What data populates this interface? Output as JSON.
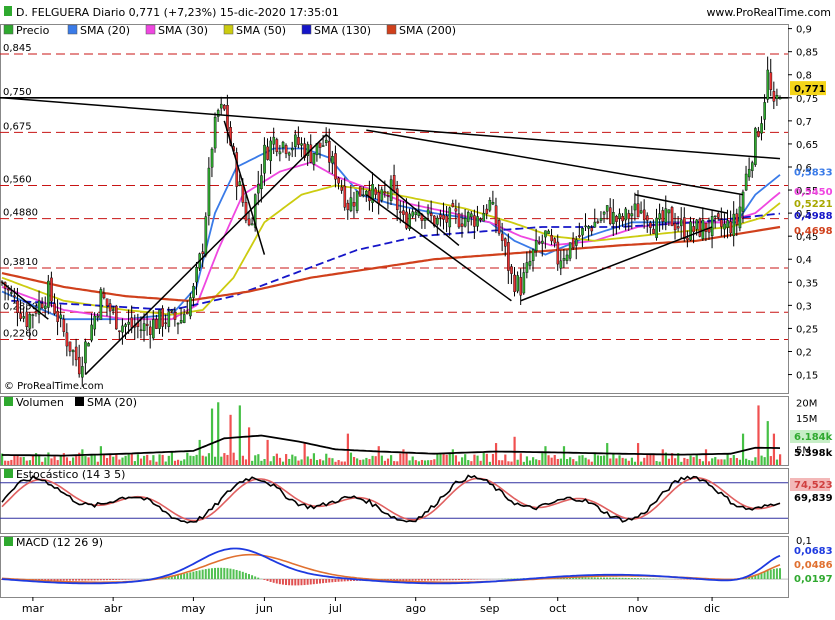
{
  "header": {
    "title": "D. FELGUERA Diario 0,771 (+7,23%) 15-dic-2020 17:35:01",
    "site": "www.ProRealTime.com",
    "copyright": "© ProRealTime.com"
  },
  "colors": {
    "price_up": "#2fa92f",
    "price_down": "#e63030",
    "sma20": "#3a7be8",
    "sma30": "#ef47e0",
    "sma50": "#cccc10",
    "sma130": "#1515c8",
    "sma200": "#d0401c",
    "resistance": "#c81414",
    "trendline": "#000000",
    "volume_up": "#45c045",
    "volume_down": "#f05050",
    "stoch_k": "#000000",
    "stoch_d": "#e06060",
    "stoch_fill": "#c8c8c8",
    "macd_line": "#1e3ae0",
    "macd_signal": "#e07030",
    "hist_pos": "#52c052",
    "hist_neg": "#e05050",
    "axis_highlight_last": "#f5d51a"
  },
  "chart_data": [
    {
      "panel": "price",
      "type": "candlestick",
      "legend": [
        {
          "name": "Precio",
          "color": "#2fa92f"
        },
        {
          "name": "SMA (20)",
          "color": "#3a7be8"
        },
        {
          "name": "SMA (30)",
          "color": "#ef47e0"
        },
        {
          "name": "SMA (50)",
          "color": "#cccc10"
        },
        {
          "name": "SMA (130)",
          "color": "#1515c8"
        },
        {
          "name": "SMA (200)",
          "color": "#d0401c"
        }
      ],
      "x_months": [
        "mar",
        "abr",
        "may",
        "jun",
        "jul",
        "ago",
        "sep",
        "oct",
        "nov",
        "dic"
      ],
      "ylim": [
        0.11,
        0.91
      ],
      "y_ticks": [
        "0,9",
        "0,85",
        "0,8",
        "0,75",
        "0,7",
        "0,65",
        "0,6",
        "0,55",
        "0,5",
        "0,45",
        "0,4",
        "0,35",
        "0,3",
        "0,25",
        "0,2",
        "0,15"
      ],
      "resistance_levels": [
        {
          "value": 0.845,
          "label": "0,845"
        },
        {
          "value": 0.75,
          "label": "0,750"
        },
        {
          "value": 0.675,
          "label": "0,675"
        },
        {
          "value": 0.56,
          "label": "0,560"
        },
        {
          "value": 0.488,
          "label": "0,4880"
        },
        {
          "value": 0.381,
          "label": "0,3810"
        },
        {
          "value": 0.285,
          "label": "0,2850"
        },
        {
          "value": 0.226,
          "label": "0,2260"
        }
      ],
      "last_values": [
        {
          "label": "0,771",
          "value": 0.771,
          "color": "#000000",
          "bg": "#f5d51a"
        },
        {
          "label": "0,5833",
          "value": 0.5833,
          "color": "#3a7be8"
        },
        {
          "label": "0,5450",
          "value": 0.545,
          "color": "#ef47e0"
        },
        {
          "label": "0,5221",
          "value": 0.5221,
          "color": "#a8a800"
        },
        {
          "label": "0,4988",
          "value": 0.4988,
          "color": "#1515c8"
        },
        {
          "label": "0,4698",
          "value": 0.4698,
          "color": "#d0401c"
        }
      ],
      "anchors": [
        [
          0,
          0.35
        ],
        [
          8,
          0.27
        ],
        [
          15,
          0.33
        ],
        [
          20,
          0.24
        ],
        [
          25,
          0.17
        ],
        [
          32,
          0.32
        ],
        [
          38,
          0.26
        ],
        [
          45,
          0.25
        ],
        [
          52,
          0.27
        ],
        [
          58,
          0.27
        ],
        [
          62,
          0.33
        ],
        [
          65,
          0.43
        ],
        [
          68,
          0.65
        ],
        [
          70,
          0.72
        ],
        [
          72,
          0.72
        ],
        [
          76,
          0.58
        ],
        [
          80,
          0.47
        ],
        [
          85,
          0.63
        ],
        [
          88,
          0.66
        ],
        [
          92,
          0.65
        ],
        [
          96,
          0.65
        ],
        [
          100,
          0.63
        ],
        [
          104,
          0.65
        ],
        [
          108,
          0.59
        ],
        [
          112,
          0.52
        ],
        [
          118,
          0.56
        ],
        [
          122,
          0.52
        ],
        [
          126,
          0.55
        ],
        [
          130,
          0.48
        ],
        [
          134,
          0.52
        ],
        [
          138,
          0.49
        ],
        [
          142,
          0.48
        ],
        [
          146,
          0.49
        ],
        [
          150,
          0.49
        ],
        [
          154,
          0.49
        ],
        [
          158,
          0.52
        ],
        [
          162,
          0.44
        ],
        [
          165,
          0.36
        ],
        [
          168,
          0.34
        ],
        [
          172,
          0.41
        ],
        [
          176,
          0.45
        ],
        [
          180,
          0.4
        ],
        [
          184,
          0.43
        ],
        [
          190,
          0.47
        ],
        [
          196,
          0.5
        ],
        [
          200,
          0.48
        ],
        [
          204,
          0.5
        ],
        [
          208,
          0.51
        ],
        [
          212,
          0.47
        ],
        [
          216,
          0.49
        ],
        [
          222,
          0.46
        ],
        [
          228,
          0.47
        ],
        [
          234,
          0.47
        ],
        [
          238,
          0.48
        ],
        [
          241,
          0.58
        ],
        [
          244,
          0.66
        ],
        [
          246,
          0.71
        ],
        [
          248,
          0.8
        ],
        [
          250,
          0.72
        ],
        [
          252,
          0.771
        ]
      ],
      "sma_anchors": {
        "sma20": [
          [
            0,
            0.33
          ],
          [
            20,
            0.27
          ],
          [
            40,
            0.27
          ],
          [
            55,
            0.28
          ],
          [
            63,
            0.34
          ],
          [
            69,
            0.5
          ],
          [
            76,
            0.6
          ],
          [
            88,
            0.64
          ],
          [
            98,
            0.64
          ],
          [
            106,
            0.62
          ],
          [
            116,
            0.54
          ],
          [
            126,
            0.52
          ],
          [
            140,
            0.5
          ],
          [
            150,
            0.49
          ],
          [
            158,
            0.48
          ],
          [
            166,
            0.44
          ],
          [
            176,
            0.41
          ],
          [
            190,
            0.45
          ],
          [
            204,
            0.48
          ],
          [
            216,
            0.48
          ],
          [
            228,
            0.48
          ],
          [
            238,
            0.48
          ],
          [
            244,
            0.54
          ],
          [
            252,
            0.583
          ]
        ],
        "sma30": [
          [
            0,
            0.34
          ],
          [
            20,
            0.29
          ],
          [
            40,
            0.27
          ],
          [
            55,
            0.27
          ],
          [
            63,
            0.3
          ],
          [
            70,
            0.42
          ],
          [
            78,
            0.54
          ],
          [
            90,
            0.59
          ],
          [
            100,
            0.61
          ],
          [
            108,
            0.58
          ],
          [
            120,
            0.55
          ],
          [
            132,
            0.52
          ],
          [
            146,
            0.5
          ],
          [
            158,
            0.48
          ],
          [
            168,
            0.45
          ],
          [
            178,
            0.43
          ],
          [
            192,
            0.44
          ],
          [
            206,
            0.47
          ],
          [
            220,
            0.48
          ],
          [
            234,
            0.48
          ],
          [
            244,
            0.5
          ],
          [
            252,
            0.545
          ]
        ],
        "sma50": [
          [
            0,
            0.36
          ],
          [
            20,
            0.31
          ],
          [
            40,
            0.29
          ],
          [
            55,
            0.28
          ],
          [
            65,
            0.29
          ],
          [
            75,
            0.36
          ],
          [
            85,
            0.48
          ],
          [
            97,
            0.54
          ],
          [
            108,
            0.56
          ],
          [
            120,
            0.55
          ],
          [
            135,
            0.53
          ],
          [
            150,
            0.51
          ],
          [
            165,
            0.48
          ],
          [
            178,
            0.45
          ],
          [
            192,
            0.44
          ],
          [
            206,
            0.45
          ],
          [
            220,
            0.46
          ],
          [
            236,
            0.47
          ],
          [
            246,
            0.49
          ],
          [
            252,
            0.522
          ]
        ],
        "sma130": [
          [
            3,
            0.31
          ],
          [
            30,
            0.3
          ],
          [
            55,
            0.29
          ],
          [
            75,
            0.32
          ],
          [
            95,
            0.37
          ],
          [
            115,
            0.42
          ],
          [
            135,
            0.45
          ],
          [
            155,
            0.46
          ],
          [
            175,
            0.47
          ],
          [
            200,
            0.47
          ],
          [
            225,
            0.48
          ],
          [
            252,
            0.499
          ]
        ],
        "sma200": [
          [
            0,
            0.37
          ],
          [
            20,
            0.34
          ],
          [
            40,
            0.32
          ],
          [
            60,
            0.31
          ],
          [
            80,
            0.33
          ],
          [
            100,
            0.36
          ],
          [
            120,
            0.38
          ],
          [
            140,
            0.4
          ],
          [
            160,
            0.41
          ],
          [
            180,
            0.42
          ],
          [
            200,
            0.43
          ],
          [
            225,
            0.44
          ],
          [
            252,
            0.47
          ]
        ]
      }
    },
    {
      "panel": "volume",
      "type": "bar",
      "legend": [
        {
          "name": "Volumen",
          "color": "#2fa92f"
        },
        {
          "name": "SMA (20)",
          "color": "#000000"
        }
      ],
      "ylim": [
        0,
        22000000
      ],
      "y_ticks": [
        "20M",
        "15M",
        "10M",
        "5M"
      ],
      "last_values": [
        {
          "label": "6.184k",
          "value": 6184000,
          "color": "#2fa92f"
        },
        {
          "label": "5.398k",
          "value": 5398000,
          "color": "#000000"
        }
      ],
      "spikes": [
        [
          15,
          4
        ],
        [
          26,
          5
        ],
        [
          32,
          6
        ],
        [
          55,
          4
        ],
        [
          64,
          8
        ],
        [
          68,
          18
        ],
        [
          70,
          20
        ],
        [
          74,
          16
        ],
        [
          77,
          19
        ],
        [
          80,
          12
        ],
        [
          86,
          8
        ],
        [
          98,
          7
        ],
        [
          112,
          10
        ],
        [
          122,
          6
        ],
        [
          130,
          5
        ],
        [
          146,
          5
        ],
        [
          160,
          7
        ],
        [
          166,
          9
        ],
        [
          176,
          6
        ],
        [
          182,
          6
        ],
        [
          196,
          7
        ],
        [
          206,
          7
        ],
        [
          214,
          5
        ],
        [
          228,
          5
        ],
        [
          240,
          10
        ],
        [
          245,
          19
        ],
        [
          248,
          14
        ],
        [
          250,
          10
        ]
      ],
      "sma_anchors": [
        [
          0,
          3.2
        ],
        [
          20,
          3.0
        ],
        [
          40,
          3.6
        ],
        [
          62,
          4.5
        ],
        [
          72,
          8.5
        ],
        [
          84,
          9.4
        ],
        [
          96,
          7.5
        ],
        [
          108,
          5.0
        ],
        [
          120,
          4.4
        ],
        [
          140,
          3.6
        ],
        [
          160,
          4.3
        ],
        [
          180,
          4.0
        ],
        [
          200,
          3.6
        ],
        [
          220,
          3.3
        ],
        [
          236,
          3.6
        ],
        [
          244,
          5.5
        ],
        [
          252,
          5.4
        ]
      ]
    },
    {
      "panel": "stochastic",
      "type": "line",
      "legend": [
        {
          "name": "Estocástico (14 3 5)",
          "color": "#000000"
        }
      ],
      "ylim": [
        -5,
        105
      ],
      "levels": [
        80,
        20
      ],
      "last_values": [
        {
          "label": "74,523",
          "value": 74.523,
          "color": "#d04040",
          "bg": "#f3b8b8"
        },
        {
          "label": "69,839",
          "value": 69.839,
          "color": "#000000"
        }
      ]
    },
    {
      "panel": "macd",
      "type": "line",
      "legend": [
        {
          "name": "MACD (12 26 9)",
          "color": "#1e3ae0"
        }
      ],
      "ylim": [
        -0.05,
        0.12
      ],
      "last_values": [
        {
          "label": "0,0683",
          "value": 0.0683,
          "color": "#1e3ae0"
        },
        {
          "label": "0,0486",
          "value": 0.0486,
          "color": "#e07030"
        },
        {
          "label": "0,0197",
          "value": 0.0197,
          "color": "#2fa92f"
        }
      ],
      "axis_partial_label": "0,1"
    }
  ]
}
